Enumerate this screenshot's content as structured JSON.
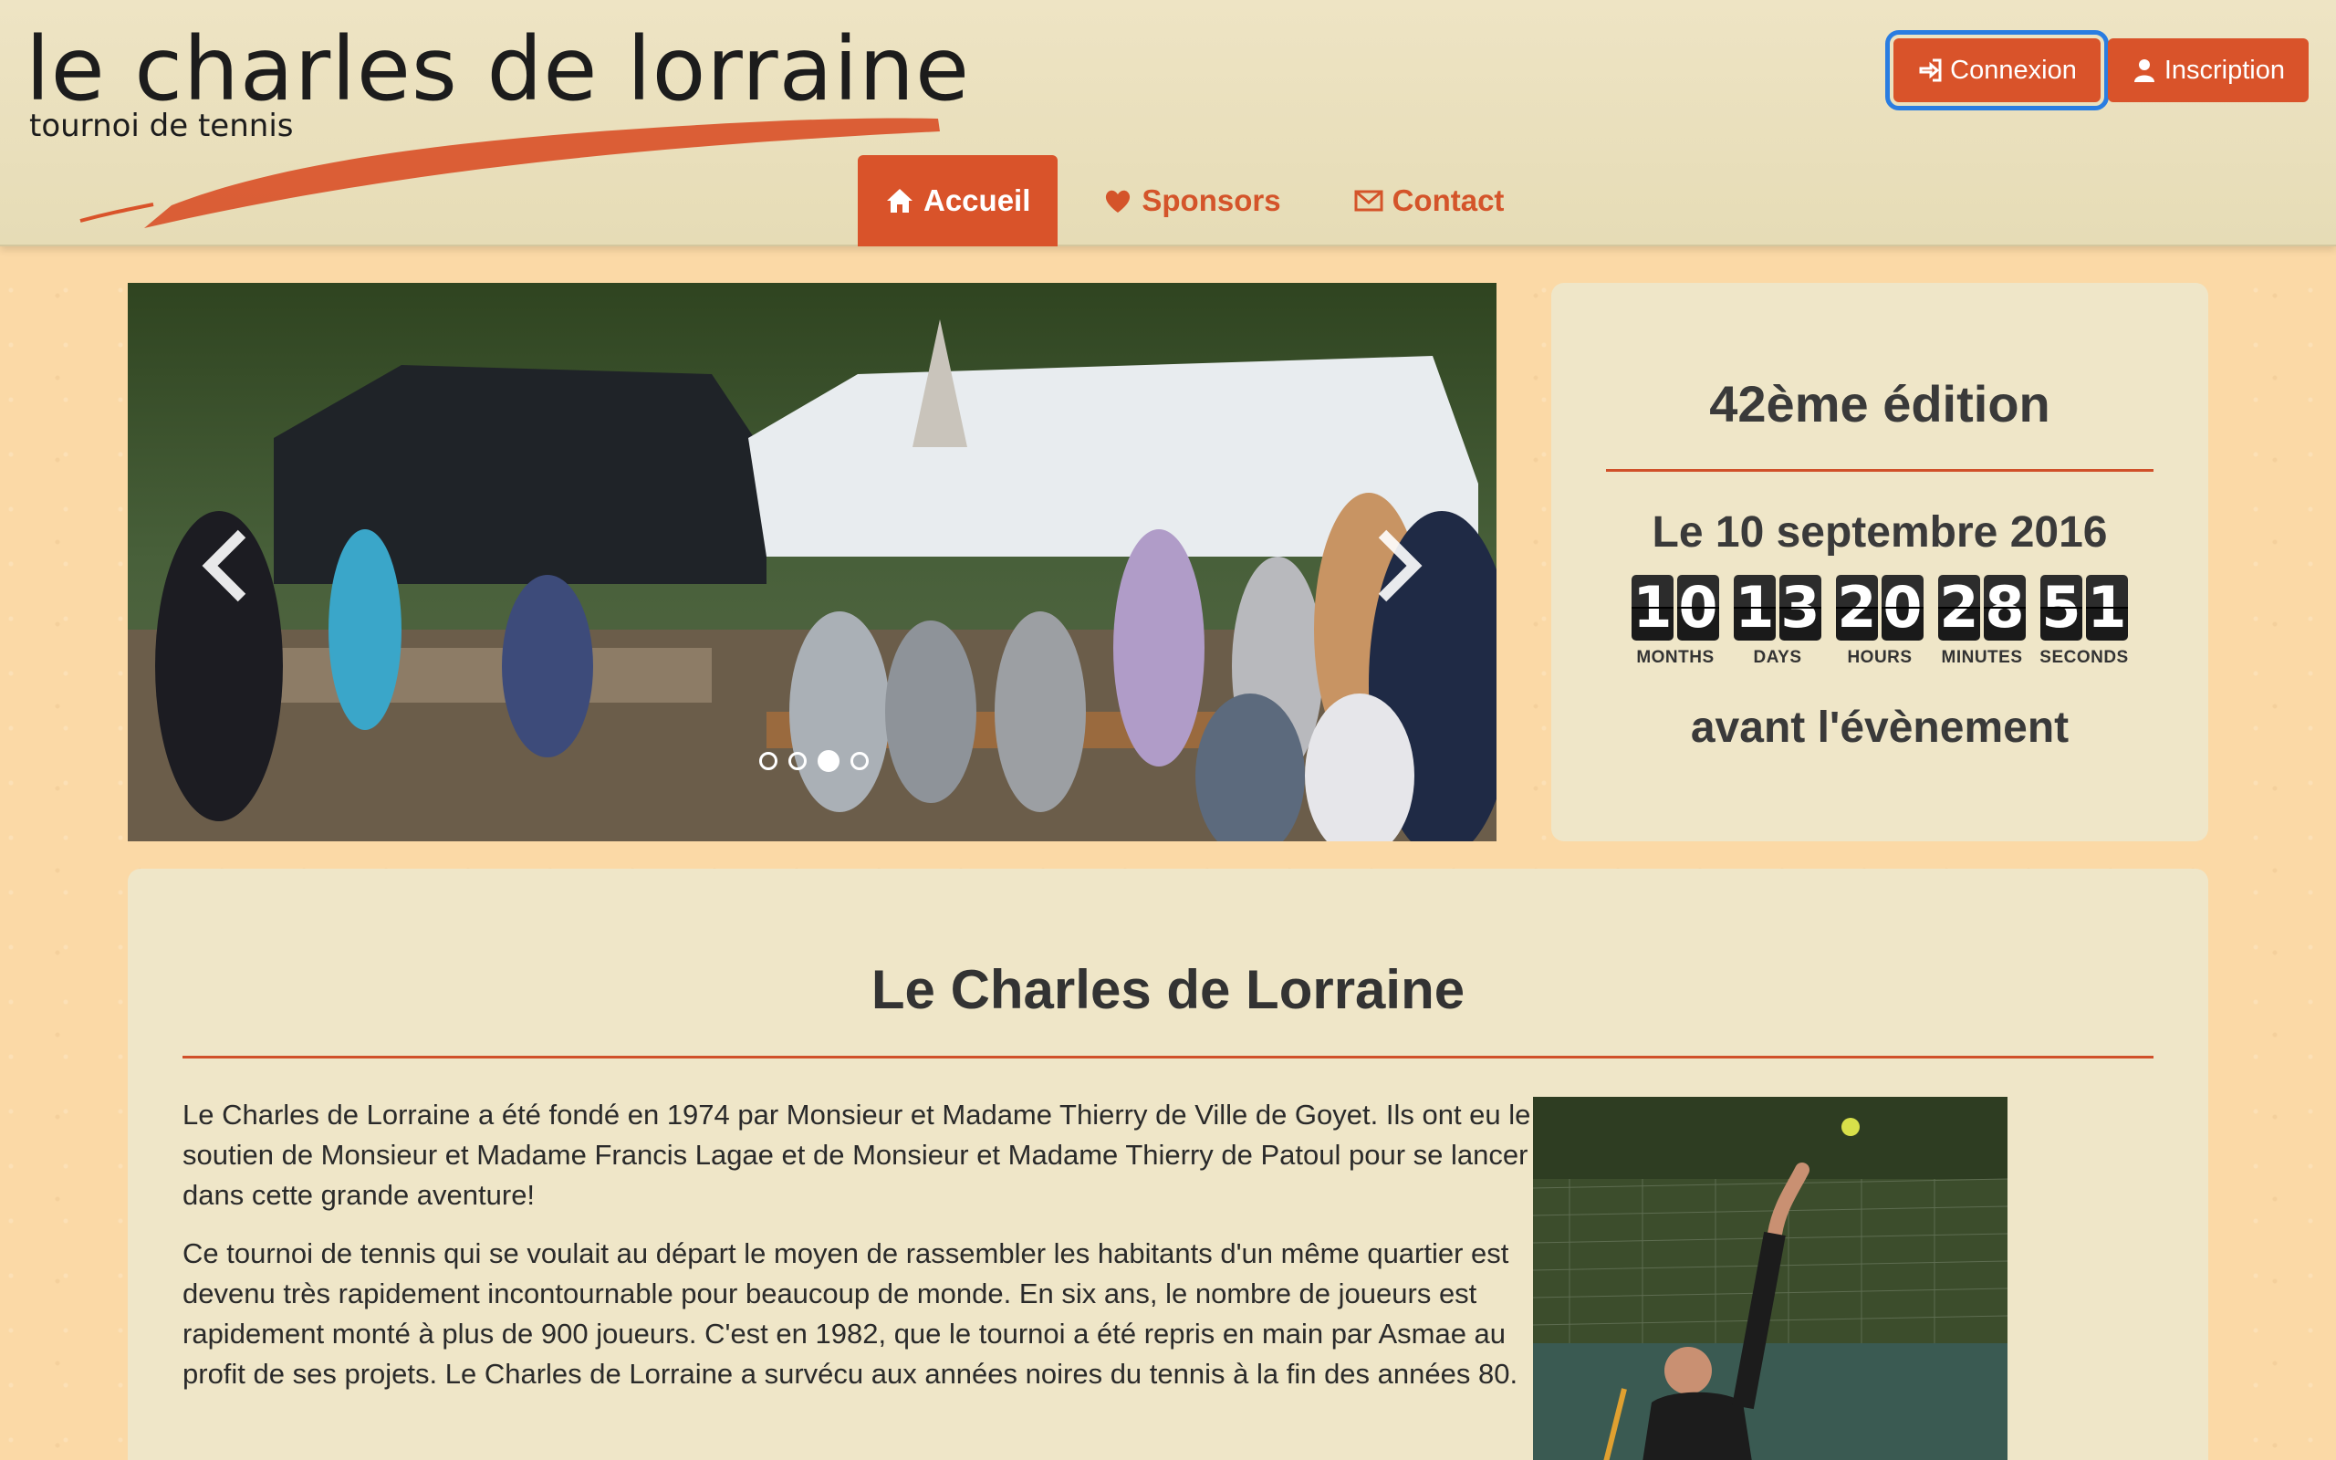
{
  "brand": {
    "title": "le charles de lorraine",
    "subtitle": "tournoi de tennis",
    "accent_color": "#d9532a"
  },
  "nav": {
    "items": [
      {
        "label": "Accueil",
        "icon": "home-icon",
        "active": true
      },
      {
        "label": "Sponsors",
        "icon": "heart-icon",
        "active": false
      },
      {
        "label": "Contact",
        "icon": "envelope-icon",
        "active": false
      }
    ]
  },
  "auth": {
    "login_label": "Connexion",
    "register_label": "Inscription"
  },
  "carousel": {
    "slide_count": 4,
    "active_slide": 3
  },
  "countdown": {
    "edition": "42ème édition",
    "date": "Le 10 septembre 2016",
    "units": [
      {
        "value": "10",
        "label": "MONTHS"
      },
      {
        "value": "13",
        "label": "DAYS"
      },
      {
        "value": "20",
        "label": "HOURS"
      },
      {
        "value": "28",
        "label": "MINUTES"
      },
      {
        "value": "51",
        "label": "SECONDS"
      }
    ],
    "after_text": "avant l'évènement"
  },
  "about": {
    "title": "Le Charles de Lorraine",
    "paragraphs": [
      "Le Charles de Lorraine a été fondé en 1974 par Monsieur et Madame Thierry de Ville de Goyet. Ils ont eu le soutien de Monsieur et Madame Francis Lagae et de Monsieur et Madame Thierry de Patoul pour se lancer dans cette grande aventure!",
      "Ce tournoi de tennis qui se voulait au départ le moyen de rassembler les habitants d'un même quartier est devenu très rapidement incontournable pour beaucoup de monde. En six ans, le nombre de joueurs est rapidement monté à plus de 900 joueurs. C'est en 1982, que le tournoi a été repris en main par Asmae au profit de ses projets. Le Charles de Lorraine a survécu aux années noires du tennis à la fin des années 80."
    ]
  }
}
